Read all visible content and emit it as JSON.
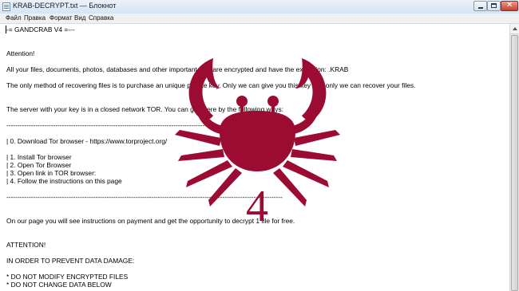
{
  "window": {
    "title": "KRAB-DECRYPT.txt — Блокнот"
  },
  "menu": {
    "items": [
      "Файл",
      "Правка",
      "Формат",
      "Вид",
      "Справка"
    ]
  },
  "document": {
    "lines": [
      "-= GANDCRAB V4  =---",
      "",
      "",
      "Attention!",
      "",
      "All your files, documents, photos, databases and other important files are encrypted and have the extension: .KRAB",
      "",
      "The only method of recovering files is to purchase an unique private key. Only we can give you this key and only we can recover your files.",
      "",
      "",
      "The server with your key is in a closed network TOR. You can get there by the following ways:",
      "",
      "----------------------------------------------------------------------------------------------------------------------------",
      "",
      "| 0. Download Tor browser - https://www.torproject.org/",
      "",
      "| 1. Install Tor browser",
      "| 2. Open Tor Browser",
      "| 3. Open link in TOR browser:",
      "| 4. Follow the instructions on this page",
      "",
      "----------------------------------------------------------------------------------------------------------------------------",
      "",
      "",
      "On our page you will see instructions on payment and get the opportunity to decrypt 1 file for free.",
      "",
      "",
      "ATTENTION!",
      "",
      "IN ORDER TO PREVENT DATA DAMAGE:",
      "",
      "* DO NOT MODIFY ENCRYPTED FILES",
      "* DO NOT CHANGE DATA BELOW"
    ]
  },
  "logo": {
    "version_digit": "4",
    "color": "#9b0b32"
  },
  "colors": {
    "titlebar": "#dbe6f4",
    "menubar": "#f0f0f0",
    "close_button": "#c4422f"
  }
}
